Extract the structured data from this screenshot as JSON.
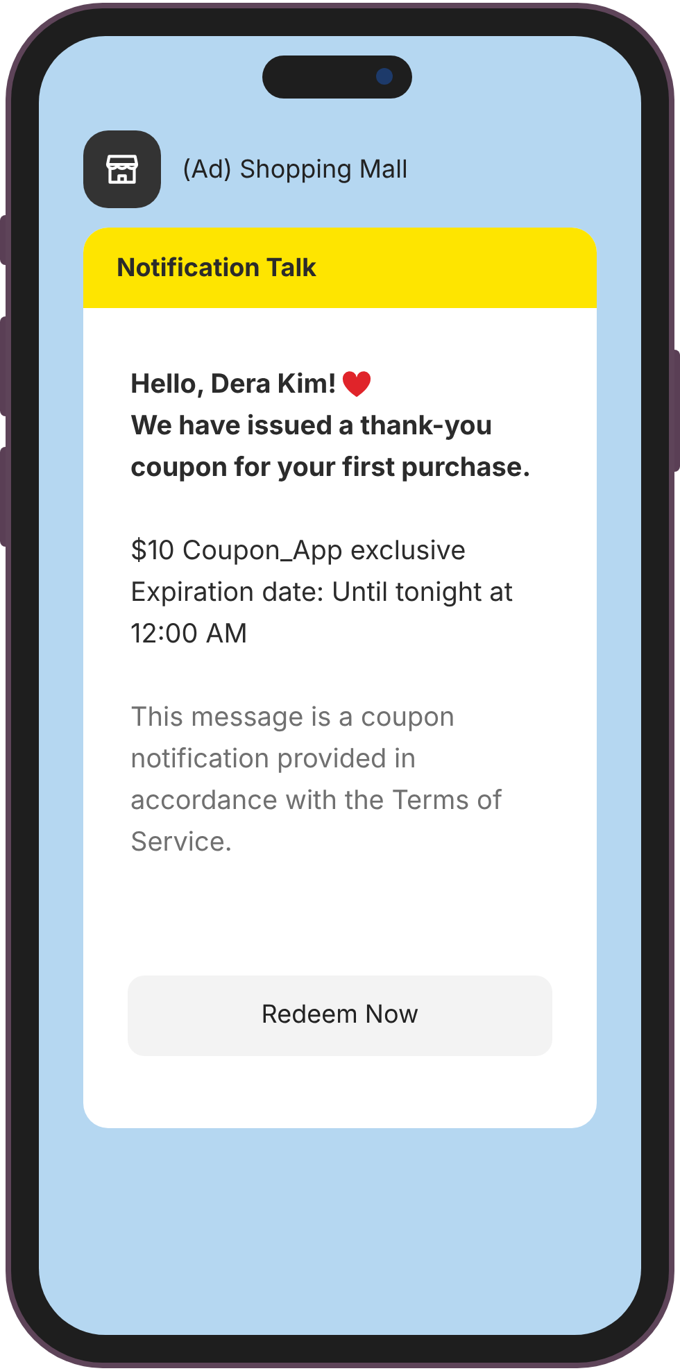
{
  "sender": {
    "name": "(Ad) Shopping Mall"
  },
  "card": {
    "header": "Notification Talk",
    "greeting": "Hello, Dera Kim!",
    "headline": "We have issued a thank-you coupon for your first purchase.",
    "coupon_lines": [
      "$10 Coupon_App exclusive",
      "Expiration date: Until tonight at 12:00 AM"
    ],
    "notice": "This message is a coupon notification provided in accordance with the Terms of Service.",
    "button": "Redeem Now"
  }
}
